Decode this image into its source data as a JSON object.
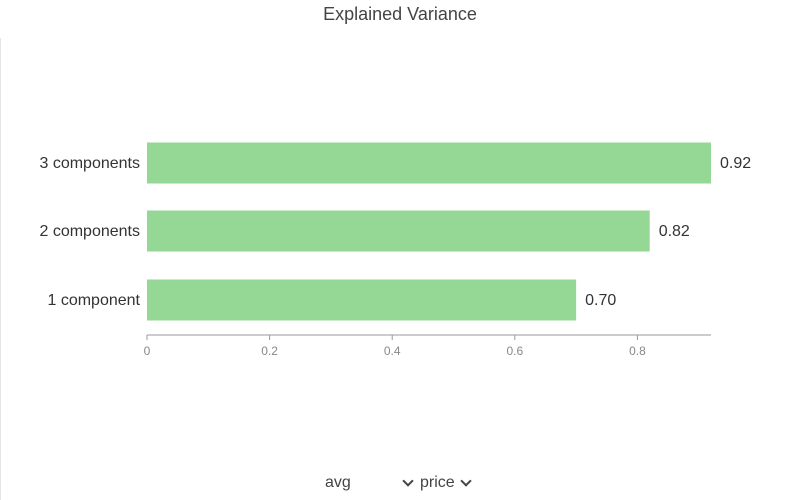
{
  "chart_data": {
    "type": "bar",
    "orientation": "horizontal",
    "title": "Explained Variance",
    "categories": [
      "3 components",
      "2 components",
      "1 component"
    ],
    "values": [
      0.92,
      0.82,
      0.7
    ],
    "value_labels": [
      "0.92",
      "0.82",
      "0.70"
    ],
    "x_ticks": [
      "0",
      "0.2",
      "0.4",
      "0.6",
      "0.8"
    ],
    "xlim": [
      0,
      0.92
    ],
    "grid": false,
    "bar_color": "#95d795"
  },
  "controls": {
    "aggregation": "avg",
    "field": "price"
  }
}
